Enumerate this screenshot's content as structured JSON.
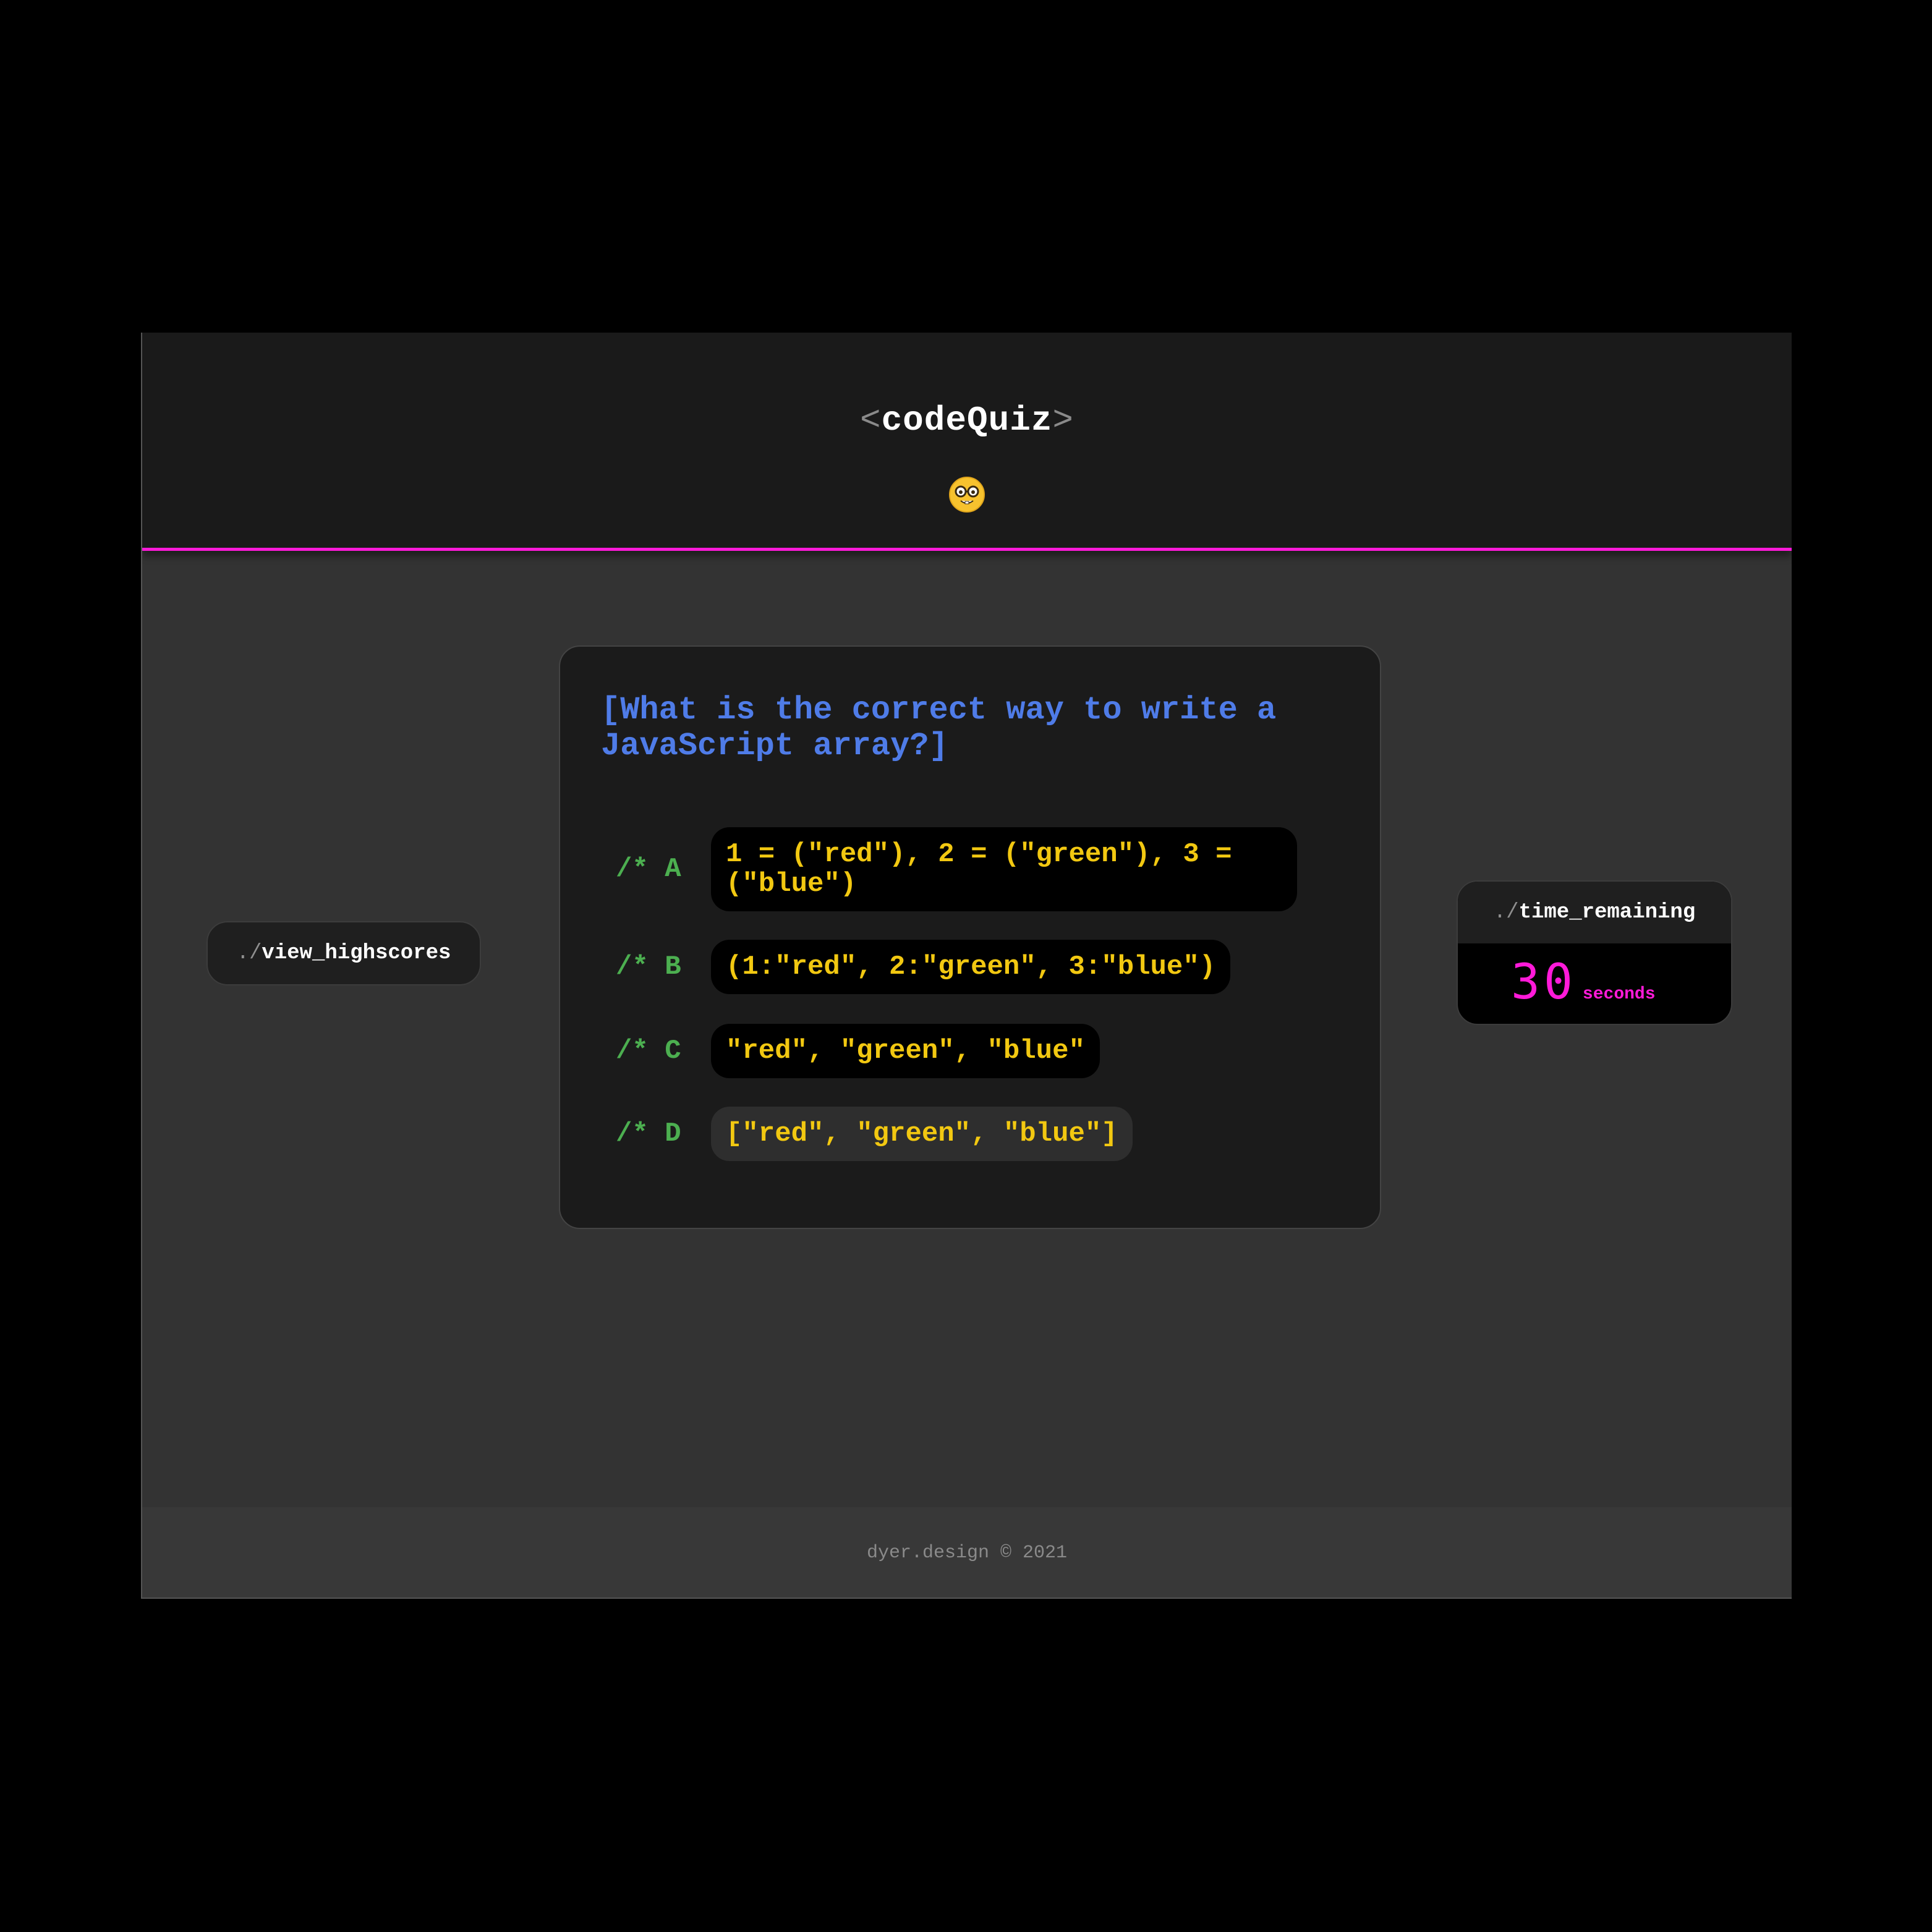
{
  "header": {
    "title_open": "<",
    "title": "codeQuiz",
    "title_close": ">",
    "emoji_icon": "nerd-face-emoji",
    "accent_color": "#ff1ad9"
  },
  "highscores": {
    "prefix": "./",
    "label": "view_highscores"
  },
  "question": {
    "text": "[What is the correct way to write a JavaScript array?]",
    "choices": [
      {
        "letter": "/* A",
        "answer": "1 = (\"red\"), 2 = (\"green\"), 3 =\n(\"blue\")"
      },
      {
        "letter": "/* B",
        "answer": "(1:\"red\", 2:\"green\", 3:\"blue\")"
      },
      {
        "letter": "/* C",
        "answer": "\"red\", \"green\", \"blue\""
      },
      {
        "letter": "/* D",
        "answer": "[\"red\", \"green\", \"blue\"]"
      }
    ]
  },
  "timer": {
    "prefix": "./",
    "label": "time_remaining",
    "value": "30",
    "unit": "seconds"
  },
  "footer": {
    "text": "dyer.design © 2021"
  },
  "colors": {
    "question": "#4f7ce8",
    "choice_letter": "#4caf50",
    "choice_text": "#f2c811",
    "timer": "#ff1ad9"
  }
}
